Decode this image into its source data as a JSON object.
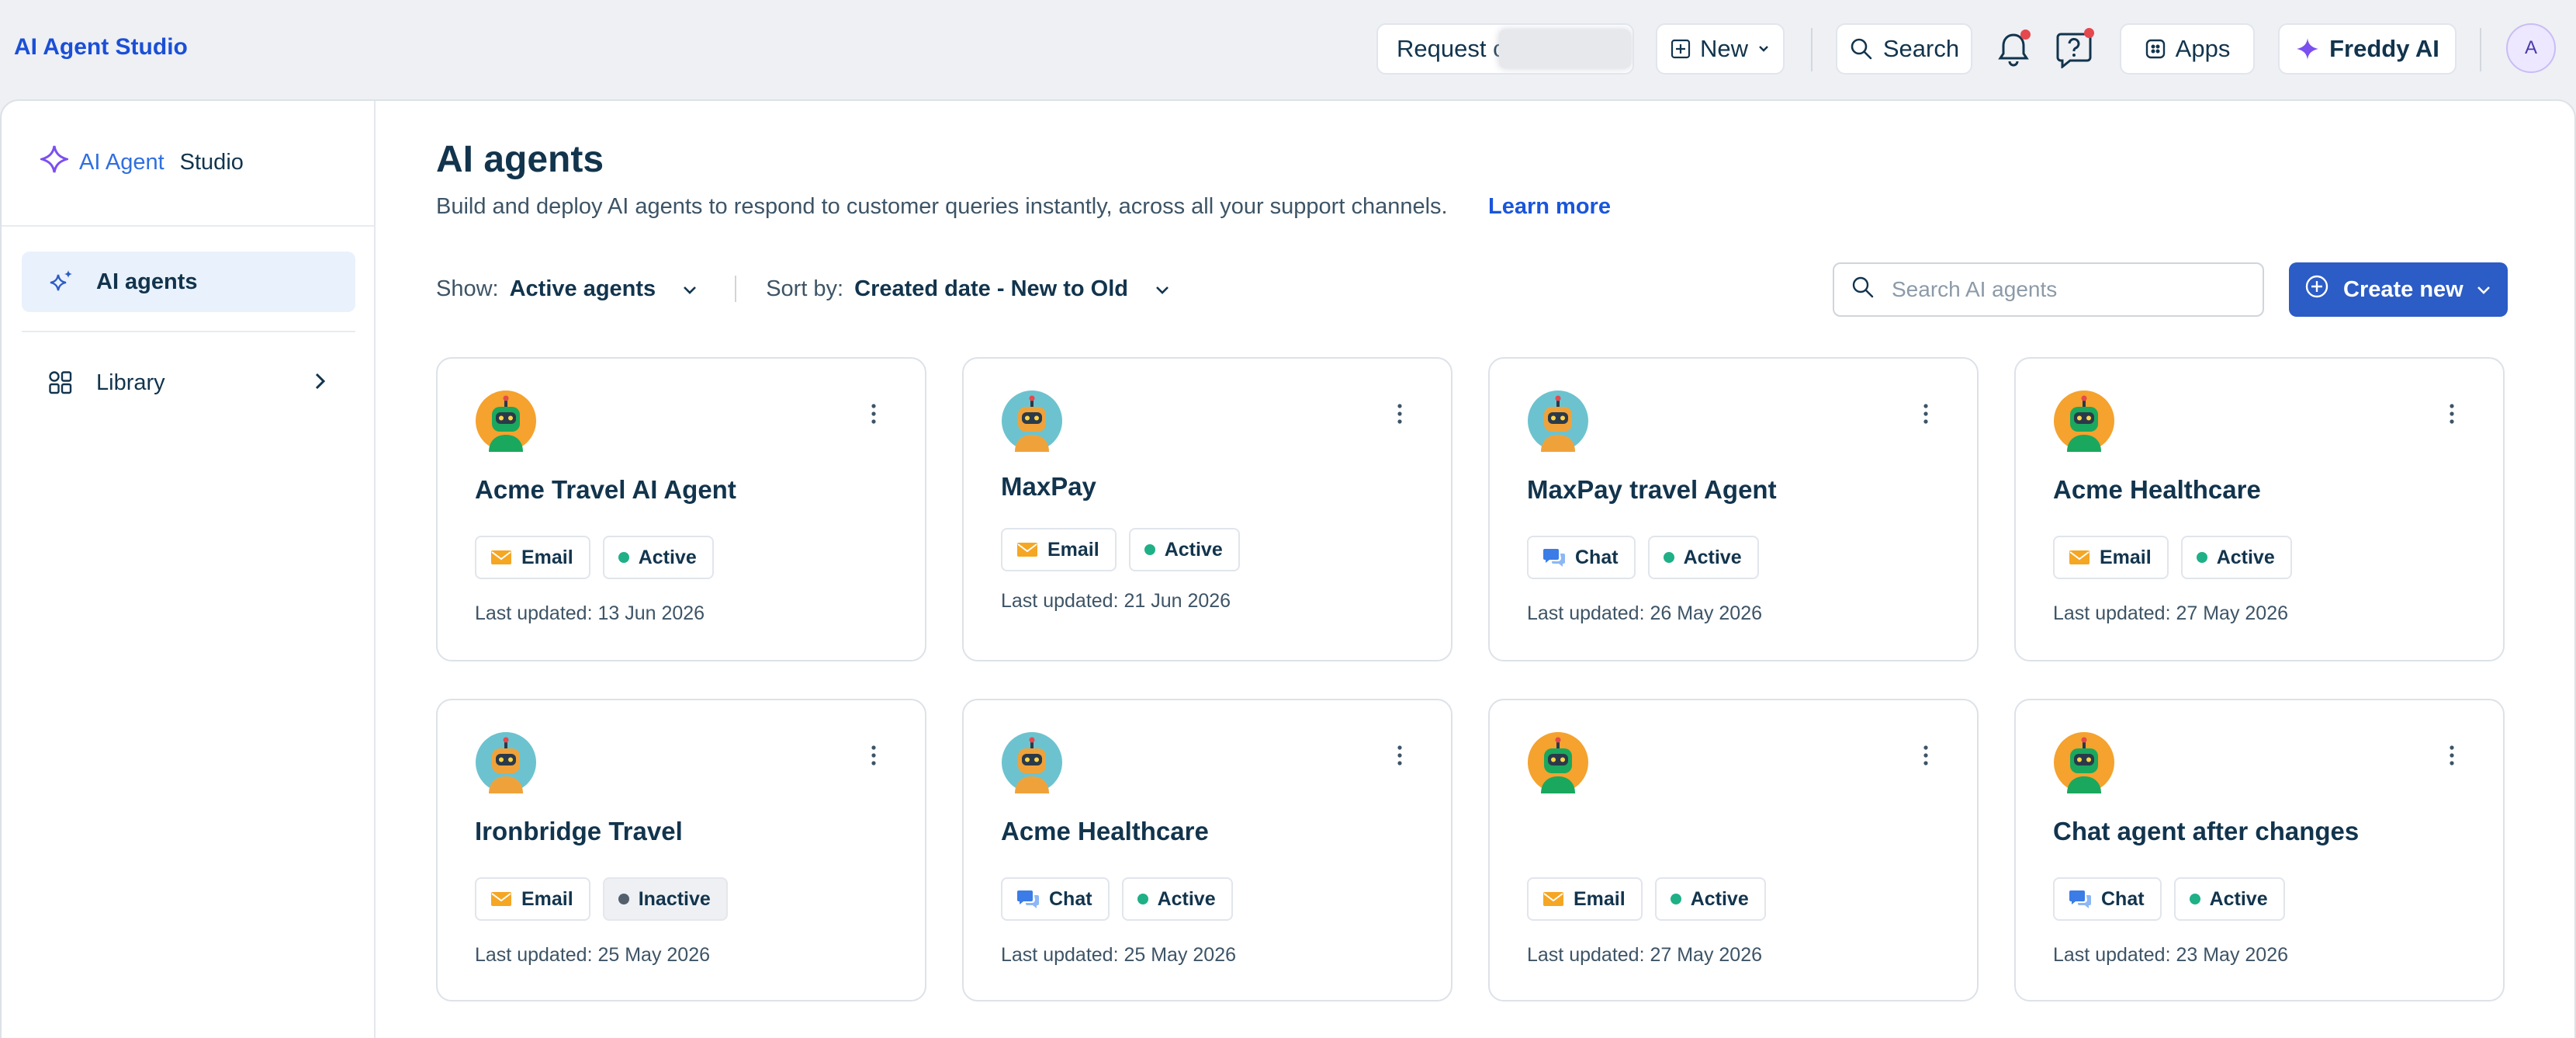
{
  "app": {
    "brand": "AI Agent Studio"
  },
  "topbar": {
    "request_label": "Request c",
    "new_label": "New",
    "search_label": "Search",
    "apps_label": "Apps",
    "freddy_label": "Freddy AI",
    "avatar_initial": "A"
  },
  "sidebar": {
    "brand_part1": "AI Agent",
    "brand_part2": "Studio",
    "items": [
      {
        "label": "AI agents",
        "icon": "sparkle-icon",
        "active": true
      },
      {
        "label": "Library",
        "icon": "library-icon",
        "active": false
      }
    ]
  },
  "page": {
    "title": "AI agents",
    "subtitle": "Build and deploy AI agents to respond to customer queries instantly, across all your support channels.",
    "learn_more": "Learn more",
    "show_label": "Show:",
    "show_value": "Active agents",
    "sort_label": "Sort by:",
    "sort_value": "Created date - New to Old",
    "search_placeholder": "Search AI agents",
    "create_label": "Create new"
  },
  "colors": {
    "accent": "#2c5cc5",
    "brand": "#1a4fd6",
    "active_dot": "#1fb087",
    "inactive_dot": "#52606d",
    "email_icon": "#f5a623",
    "chat_icon": "#3b7ce6"
  },
  "agents": [
    {
      "name": "Acme Travel AI Agent",
      "channel": "Email",
      "status": "Active",
      "updated": "Last updated: 13 Jun 2026",
      "avatar": "green-robot-icon"
    },
    {
      "name": "MaxPay",
      "channel": "Email",
      "status": "Active",
      "updated": "Last updated: 21 Jun 2026",
      "avatar": "orange-robot-icon"
    },
    {
      "name": "MaxPay travel Agent",
      "channel": "Chat",
      "status": "Active",
      "updated": "Last updated: 26 May 2026",
      "avatar": "orange-robot-icon"
    },
    {
      "name": "Acme Healthcare",
      "channel": "Email",
      "status": "Active",
      "updated": "Last updated: 27 May 2026",
      "avatar": "green-robot-icon"
    },
    {
      "name": "Ironbridge Travel",
      "channel": "Email",
      "status": "Inactive",
      "updated": "Last updated: 25 May 2026",
      "avatar": "orange-robot-icon"
    },
    {
      "name": "Acme Healthcare",
      "channel": "Chat",
      "status": "Active",
      "updated": "Last updated: 25 May 2026",
      "avatar": "orange-robot-icon"
    },
    {
      "name": "",
      "channel": "Email",
      "status": "Active",
      "updated": "Last updated: 27 May 2026",
      "avatar": "green-robot-icon"
    },
    {
      "name": "Chat agent after changes",
      "channel": "Chat",
      "status": "Active",
      "updated": "Last updated: 23 May 2026",
      "avatar": "green-robot-icon"
    }
  ]
}
